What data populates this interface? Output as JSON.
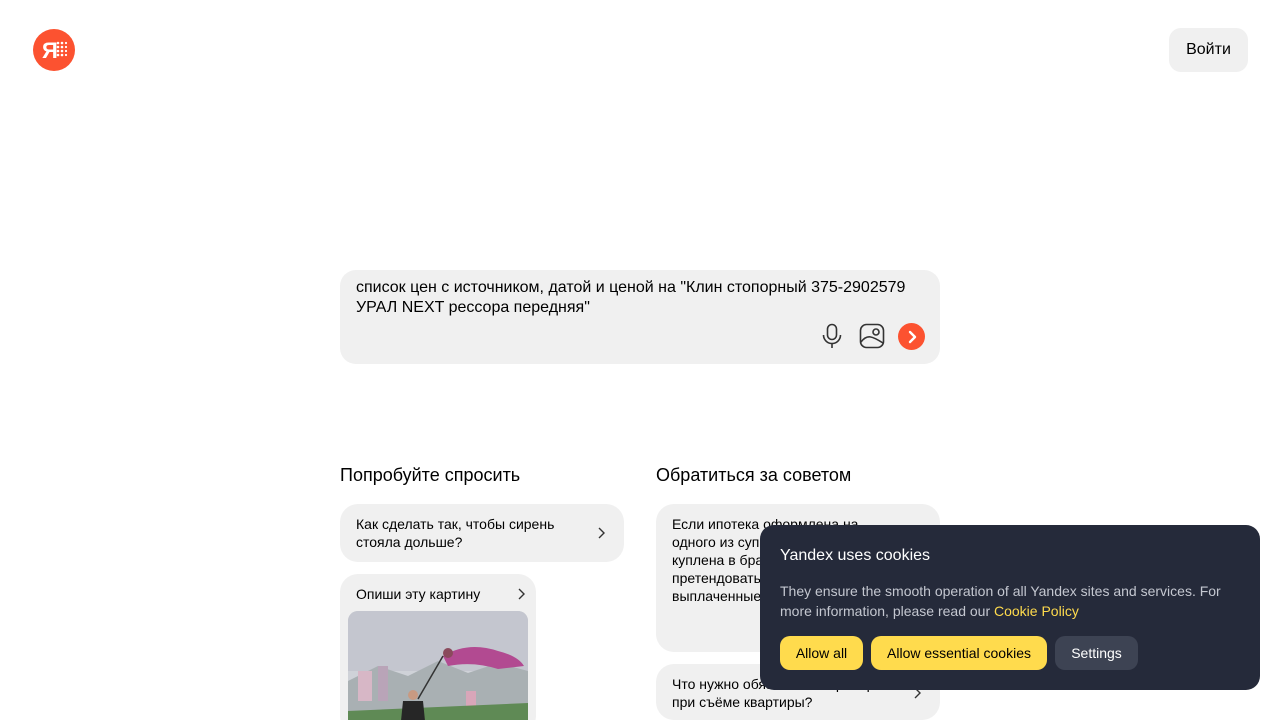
{
  "header": {
    "logo_text": "Я",
    "login_label": "Войти"
  },
  "search": {
    "query": "список цен с источником, датой и ценой на \"Клин стопорный 375-2902579 УРАЛ NEXT рессора передняя\""
  },
  "suggestions": {
    "left_title": "Попробуйте спросить",
    "right_title": "Обратиться за советом",
    "left_items": [
      "Как сделать так, чтобы сирень стояла дольше?",
      "Опиши эту картину"
    ],
    "right_items": [
      "Если ипотека оформлена на одного из супругов, а квартира куплена в браке, то кто может претендовать на вычет за выплаченные проценты?",
      "Что нужно обязательно проверить при съёме квартиры?"
    ]
  },
  "cookie": {
    "title": "Yandex uses cookies",
    "text": "They ensure the smooth operation of all Yandex sites and services. For more information, please read our ",
    "link": "Cookie Policy",
    "allow_all": "Allow all",
    "allow_essential": "Allow essential cookies",
    "settings": "Settings"
  },
  "colors": {
    "accent": "#fc5230",
    "card_bg": "#f0f0f0",
    "cookie_bg": "#252a3a",
    "cookie_button": "#ffdb4d"
  }
}
